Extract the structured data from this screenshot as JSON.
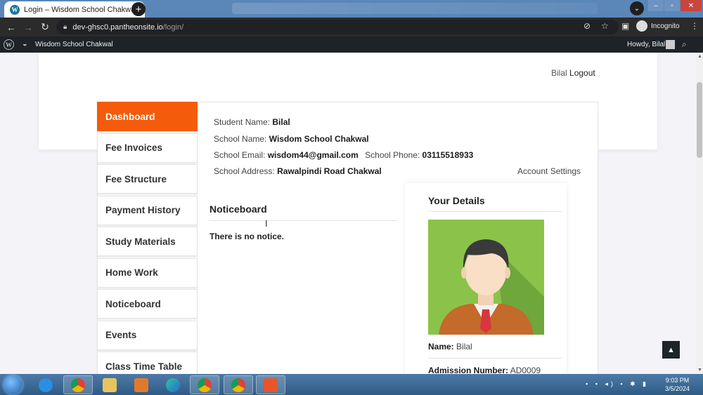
{
  "browser": {
    "tab_title": "Login – Wisdom School Chakwal",
    "tab_favicon": "W",
    "url_host": "dev-ghsc0.pantheonsite.io",
    "url_path": "/login/",
    "profile_label": "Incognito"
  },
  "adminbar": {
    "site_name": "Wisdom School Chakwal",
    "howdy": "Howdy, Bilal"
  },
  "header": {
    "user_name": "Bilal",
    "logout_label": "Logout"
  },
  "sidebar": {
    "items": [
      {
        "label": "Dashboard",
        "active": true
      },
      {
        "label": "Fee Invoices",
        "active": false
      },
      {
        "label": "Fee Structure",
        "active": false
      },
      {
        "label": "Payment History",
        "active": false
      },
      {
        "label": "Study Materials",
        "active": false
      },
      {
        "label": "Home Work",
        "active": false
      },
      {
        "label": "Noticeboard",
        "active": false
      },
      {
        "label": "Events",
        "active": false
      },
      {
        "label": "Class Time Table",
        "active": false
      }
    ]
  },
  "student_info": {
    "student_name_label": "Student Name:",
    "student_name": "Bilal",
    "school_name_label": "School Name:",
    "school_name": "Wisdom School Chakwal",
    "school_email_label": "School Email:",
    "school_email": "wisdom44@gmail.com",
    "school_phone_label": "School Phone:",
    "school_phone": "03115518933",
    "school_address_label": "School Address:",
    "school_address": "Rawalpindi Road Chakwal",
    "account_settings": "Account Settings"
  },
  "noticeboard": {
    "title": "Noticeboard",
    "empty_text": "There is no notice."
  },
  "details": {
    "title": "Your Details",
    "name_label": "Name:",
    "name": "Bilal",
    "admission_label": "Admission Number:",
    "admission": "AD0009"
  },
  "taskbar": {
    "time": "9:03 PM",
    "date": "3/5/2024"
  },
  "colors": {
    "accent": "#f45b0a",
    "photo_bg": "#8bc34a"
  }
}
